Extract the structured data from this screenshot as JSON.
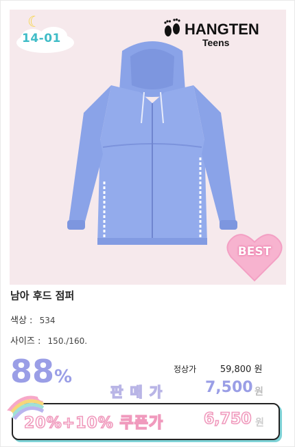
{
  "badge": {
    "number": "14-01"
  },
  "brand": {
    "name": "HANGTEN",
    "sub": "Teens"
  },
  "best_badge": {
    "label": "BEST"
  },
  "product": {
    "title": "남아 후드 점퍼",
    "color_label": "색상 :",
    "color_value": "534",
    "size_label": "사이즈 :",
    "size_value": "150./160."
  },
  "pricing": {
    "discount_number": "88",
    "discount_sign": "%",
    "regular_label": "정상가",
    "regular_price": "59,800 원",
    "sale_label": "판매가",
    "sale_price": "7,500",
    "sale_unit": "원",
    "coupon_label": "20%+10% 쿠폰가",
    "coupon_price": "6,750",
    "coupon_unit": "원"
  },
  "colors": {
    "image_bg": "#f6e9ec",
    "jacket": "#8fa8ea",
    "accent_purple": "#9a9ee6",
    "accent_pink": "#f09abd",
    "accent_teal": "#7fd3d7"
  }
}
